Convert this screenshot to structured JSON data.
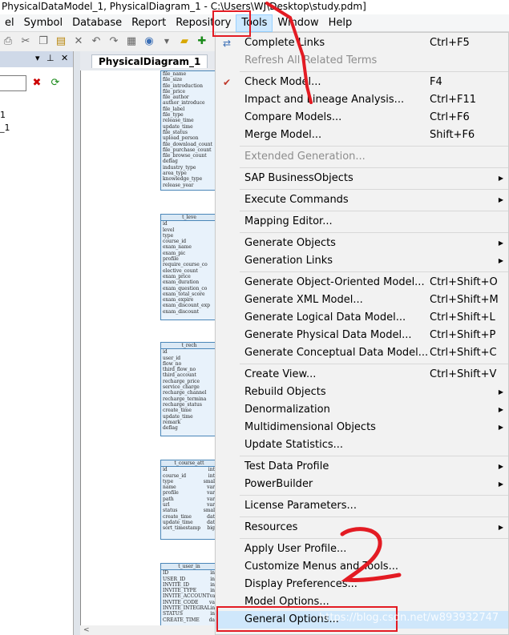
{
  "window": {
    "title": "PhysicalDataModel_1, PhysicalDiagram_1 - C:\\Users\\WJ\\Desktop\\study.pdm]"
  },
  "menubar": {
    "items": [
      "el",
      "Symbol",
      "Database",
      "Report",
      "Repository",
      "Tools",
      "Window",
      "Help"
    ],
    "active": "Tools"
  },
  "toolbar": {
    "icons": [
      "print-icon",
      "cut-icon",
      "copy-icon",
      "paste-icon",
      "delete-icon",
      "undo-icon",
      "redo-icon",
      "properties-icon",
      "model-icon",
      "chevron-down-icon",
      "folder-icon",
      "add-icon"
    ]
  },
  "browser": {
    "tree_item_1": "1",
    "tree_item_2": "_1"
  },
  "diagram": {
    "tab": "PhysicalDiagram_1",
    "tables": [
      {
        "title": "",
        "rows": [
          "file_name",
          "file_size",
          "file_introduction",
          "file_price",
          "file_author",
          "author_introduce",
          "file_label",
          "file_type",
          "release_time",
          "update_time",
          "file_status",
          "upload_person",
          "file_download_count",
          "file_purchase_count",
          "file_browse_count",
          "deflag",
          "industry_type",
          "area_type",
          "knowledge_type",
          "release_year"
        ],
        "types": []
      },
      {
        "title": "t_leve",
        "rows": [
          "id",
          "level",
          "type",
          "course_id",
          "exam_name",
          "exam_pic",
          "profile",
          "require_course_co",
          "elective_count",
          "exam_price",
          "exam_duration",
          "exam_question_co",
          "exam_total_score",
          "exam_expire",
          "exam_discount_exp",
          "exam_discount"
        ],
        "types": []
      },
      {
        "title": "t_rech",
        "rows": [
          "id",
          "user_id",
          "flow_no",
          "third_flow_no",
          "third_account",
          "recharge_price",
          "service_charge",
          "recharge_channel",
          "recharge_termina",
          "recharge_status",
          "create_time",
          "update_time",
          "remark",
          "deflag"
        ],
        "types": [
          "",
          "",
          "",
          "",
          "",
          "",
          "",
          "",
          "",
          "",
          "",
          "",
          "",
          ""
        ]
      },
      {
        "title": "t_course_att",
        "rows": [
          "id",
          "course_id",
          "type",
          "name",
          "profile",
          "path",
          "url",
          "status",
          "create_time",
          "update_time",
          "sort_timestamp"
        ],
        "types": [
          "int",
          "int",
          "smal",
          "var",
          "var",
          "var",
          "var",
          "smal",
          "dat",
          "dat",
          "big"
        ]
      },
      {
        "title": "t_user_in",
        "rows": [
          "ID",
          "USER_ID",
          "INVITE_ID",
          "INVITE_TYPE",
          "INVITE_ACCOUNT",
          "INVITE_CODE",
          "INVITE_INTEGRAL",
          "STATUS",
          "CREATE_TIME"
        ],
        "types": [
          "in",
          "in",
          "in",
          "in",
          "va",
          "va",
          "in",
          "in",
          "da"
        ]
      }
    ],
    "scroll_label": "<"
  },
  "tools_menu": {
    "groups": [
      [
        {
          "label": "Complete Links",
          "shortcut": "Ctrl+F5",
          "icon": "link-icon"
        },
        {
          "label": "Refresh All Related Terms",
          "shortcut": "",
          "disabled": true
        }
      ],
      [
        {
          "label": "Check Model...",
          "shortcut": "F4",
          "icon": "check-model-icon"
        },
        {
          "label": "Impact and Lineage Analysis...",
          "shortcut": "Ctrl+F11"
        },
        {
          "label": "Compare Models...",
          "shortcut": "Ctrl+F6"
        },
        {
          "label": "Merge Model...",
          "shortcut": "Shift+F6"
        }
      ],
      [
        {
          "label": "Extended Generation...",
          "shortcut": "",
          "disabled": true
        }
      ],
      [
        {
          "label": "SAP BusinessObjects",
          "submenu": true
        }
      ],
      [
        {
          "label": "Execute Commands",
          "submenu": true
        }
      ],
      [
        {
          "label": "Mapping Editor..."
        }
      ],
      [
        {
          "label": "Generate Objects",
          "submenu": true
        },
        {
          "label": "Generation Links",
          "submenu": true
        }
      ],
      [
        {
          "label": "Generate Object-Oriented Model...",
          "shortcut": "Ctrl+Shift+O"
        },
        {
          "label": "Generate XML Model...",
          "shortcut": "Ctrl+Shift+M"
        },
        {
          "label": "Generate Logical Data Model...",
          "shortcut": "Ctrl+Shift+L"
        },
        {
          "label": "Generate Physical Data Model...",
          "shortcut": "Ctrl+Shift+P"
        },
        {
          "label": "Generate Conceptual Data Model...",
          "shortcut": "Ctrl+Shift+C"
        }
      ],
      [
        {
          "label": "Create View...",
          "shortcut": "Ctrl+Shift+V"
        },
        {
          "label": "Rebuild Objects",
          "submenu": true
        },
        {
          "label": "Denormalization",
          "submenu": true
        },
        {
          "label": "Multidimensional Objects",
          "submenu": true
        },
        {
          "label": "Update Statistics..."
        }
      ],
      [
        {
          "label": "Test Data Profile",
          "submenu": true
        },
        {
          "label": "PowerBuilder",
          "submenu": true
        }
      ],
      [
        {
          "label": "License Parameters..."
        }
      ],
      [
        {
          "label": "Resources",
          "submenu": true
        }
      ],
      [
        {
          "label": "Apply User Profile..."
        },
        {
          "label": "Customize Menus and Tools..."
        },
        {
          "label": "Display Preferences..."
        },
        {
          "label": "Model Options..."
        },
        {
          "label": "General Options...",
          "highlighted": true
        }
      ]
    ]
  },
  "annotations": {
    "watermark": "https://blog.csdn.net/w893932747",
    "step_1": "1",
    "step_2": "2",
    "color": "#e31b23"
  }
}
